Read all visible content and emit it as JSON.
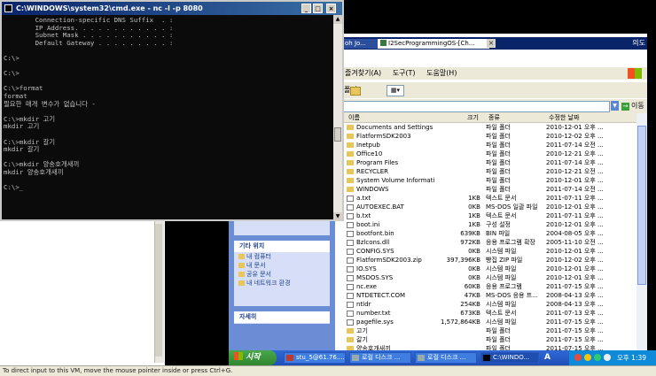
{
  "cmd": {
    "title": "C:\\WINDOWS\\system32\\cmd.exe - nc -l -p 8080",
    "output": "        Connection-specific DNS Suffix  . :\n        IP Address. . . . . . . . . . . . :\n        Subnet Mask . . . . . . . . . . . :\n        Default Gateway . . . . . . . . . :\n\nC:\\>\n\nC:\\>\n\nC:\\>format\nformat\n필요한 매개 변수가 없습니다 -\n\nC:\\>mkdir 고기\nmkdir 고기\n\nC:\\>mkdir 갈기\nmkdir 갈기\n\nC:\\>mkdir 양송호개새끼\nmkdir 양송호개새끼\n\nC:\\>_"
  },
  "ie_tabs": {
    "tab1": "oh Jo...",
    "tab2": "I2SecProgrammingOS-[Ch...",
    "tab_label": "의도"
  },
  "explorer": {
    "menu": [
      "즐겨찾기(A)",
      "도구(T)",
      "도움말(H)"
    ],
    "folders_label": "폴더",
    "go_label": "이동",
    "columns": {
      "name": "이름",
      "size": "크기",
      "type": "종류",
      "date": "수정한 날짜"
    },
    "files": [
      {
        "name": "Documents and Settings",
        "size": "",
        "type": "파일 폴더",
        "date": "2010-12-01 오후 ...",
        "folder": true
      },
      {
        "name": "FlatformSDK2003",
        "size": "",
        "type": "파일 폴더",
        "date": "2010-12-02 오후 ...",
        "folder": true
      },
      {
        "name": "Inetpub",
        "size": "",
        "type": "파일 폴더",
        "date": "2011-07-14 오전 ...",
        "folder": true
      },
      {
        "name": "Office10",
        "size": "",
        "type": "파일 폴더",
        "date": "2010-12-21 오후 ...",
        "folder": true
      },
      {
        "name": "Program Files",
        "size": "",
        "type": "파일 폴더",
        "date": "2011-07-14 오후 ...",
        "folder": true
      },
      {
        "name": "RECYCLER",
        "size": "",
        "type": "파일 폴더",
        "date": "2010-12-21 오전 ...",
        "folder": true
      },
      {
        "name": "System Volume Information",
        "size": "",
        "type": "파일 폴더",
        "date": "2010-12-01 오후 ...",
        "folder": true
      },
      {
        "name": "WINDOWS",
        "size": "",
        "type": "파일 폴더",
        "date": "2011-07-14 오전 ...",
        "folder": true
      },
      {
        "name": "a.txt",
        "size": "1KB",
        "type": "텍스트 문서",
        "date": "2011-07-11 오후 ...",
        "folder": false
      },
      {
        "name": "AUTOEXEC.BAT",
        "size": "0KB",
        "type": "MS-DOS 일괄 파일",
        "date": "2010-12-01 오후 ...",
        "folder": false
      },
      {
        "name": "b.txt",
        "size": "1KB",
        "type": "텍스트 문서",
        "date": "2011-07-11 오후 ...",
        "folder": false
      },
      {
        "name": "boot.ini",
        "size": "1KB",
        "type": "구성 설정",
        "date": "2010-12-01 오후 ...",
        "folder": false
      },
      {
        "name": "bootfont.bin",
        "size": "639KB",
        "type": "BIN 파일",
        "date": "2004-08-05 오후 ...",
        "folder": false
      },
      {
        "name": "Bzlcons.dll",
        "size": "972KB",
        "type": "응용 프로그램 확장",
        "date": "2005-11-10 오전 ...",
        "folder": false
      },
      {
        "name": "CONFIG.SYS",
        "size": "0KB",
        "type": "시스템 파일",
        "date": "2010-12-01 오후 ...",
        "folder": false
      },
      {
        "name": "FlatformSDK2003.zip",
        "size": "397,396KB",
        "type": "빵집 ZIP 파일",
        "date": "2010-12-02 오후 ...",
        "folder": false
      },
      {
        "name": "IO.SYS",
        "size": "0KB",
        "type": "시스템 파일",
        "date": "2010-12-01 오후 ...",
        "folder": false
      },
      {
        "name": "MSDOS.SYS",
        "size": "0KB",
        "type": "시스템 파일",
        "date": "2010-12-01 오후 ...",
        "folder": false
      },
      {
        "name": "nc.exe",
        "size": "60KB",
        "type": "응용 프로그램",
        "date": "2011-07-15 오후 ...",
        "folder": false
      },
      {
        "name": "NTDETECT.COM",
        "size": "47KB",
        "type": "MS-DOS 응용 프...",
        "date": "2008-04-13 오후 ...",
        "folder": false
      },
      {
        "name": "ntldr",
        "size": "254KB",
        "type": "시스템 파일",
        "date": "2008-04-13 오후 ...",
        "folder": false
      },
      {
        "name": "number.txt",
        "size": "673KB",
        "type": "텍스트 문서",
        "date": "2011-07-13 오후 ...",
        "folder": false
      },
      {
        "name": "pagefile.sys",
        "size": "1,572,864KB",
        "type": "시스템 파일",
        "date": "2011-07-15 오후 ...",
        "folder": false
      },
      {
        "name": "고기",
        "size": "",
        "type": "파일 폴더",
        "date": "2011-07-15 오후 ...",
        "folder": true
      },
      {
        "name": "갈기",
        "size": "",
        "type": "파일 폴더",
        "date": "2011-07-15 오후 ...",
        "folder": true
      },
      {
        "name": "양송호개새끼",
        "size": "",
        "type": "파일 폴더",
        "date": "2011-07-15 오후 ...",
        "folder": true
      }
    ]
  },
  "task_pane": {
    "other_places_title": "기타 위치",
    "other_places": [
      "내 컴퓨터",
      "내 문서",
      "공유 문서",
      "내 네트워크 환경"
    ],
    "details_title": "자세히"
  },
  "taskbar": {
    "start_label": "시작",
    "tasks": [
      "stu_5@61.76....",
      "로컬 디스크 ...",
      "로컬 디스크 ...",
      "C:\\WINDO..."
    ],
    "lang": "A",
    "clock": "오후 1:39"
  },
  "host_statusbar": "To direct input to this VM, move the mouse pointer inside or press Ctrl+G."
}
